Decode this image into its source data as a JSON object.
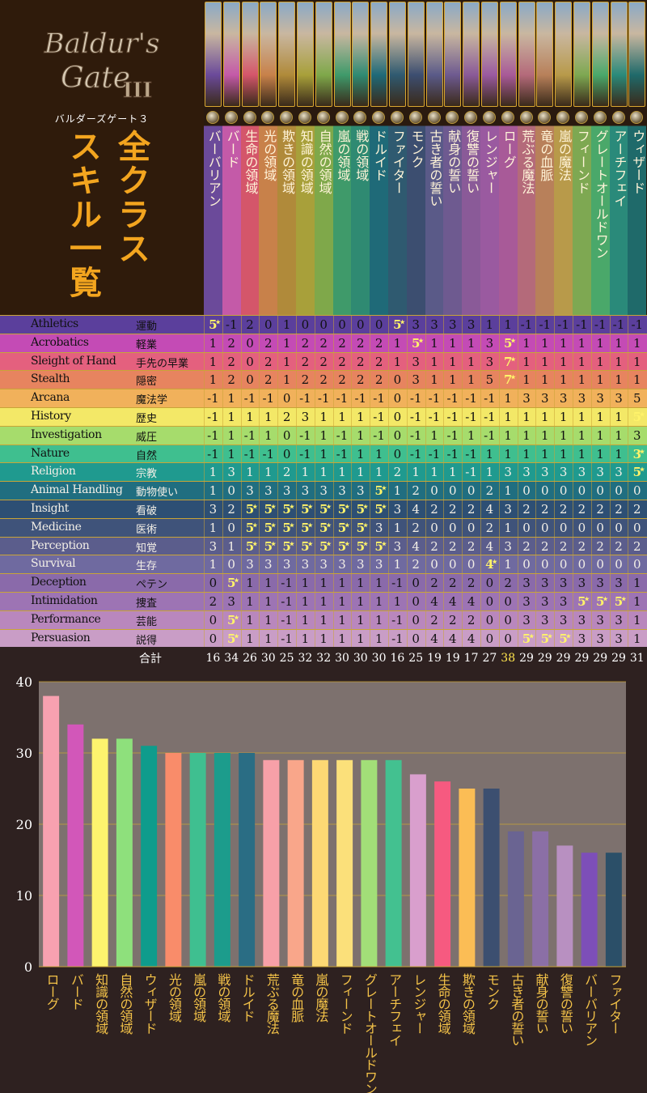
{
  "header": {
    "logo_text_line1": "Baldur's",
    "logo_text_line2": "Gate",
    "logo_numeral": "III",
    "subtitle": "バルダーズゲート３",
    "title_line1": "全クラス",
    "title_line2": "スキル一覧"
  },
  "classes": [
    {
      "label": "バーバリアン",
      "color": "#6b4a9a"
    },
    {
      "label": "バード",
      "color": "#c45aa8"
    },
    {
      "label": "生命の領域",
      "color": "#d4566a"
    },
    {
      "label": "光の領域",
      "color": "#c8814a"
    },
    {
      "label": "欺きの領域",
      "color": "#b08a3a"
    },
    {
      "label": "知識の領域",
      "color": "#a8a03a"
    },
    {
      "label": "自然の領域",
      "color": "#7fa84a"
    },
    {
      "label": "嵐の領域",
      "color": "#3f9a6a"
    },
    {
      "label": "戦の領域",
      "color": "#2f8a72"
    },
    {
      "label": "ドルイド",
      "color": "#1f6a78"
    },
    {
      "label": "ファイター",
      "color": "#2f5a70"
    },
    {
      "label": "モンク",
      "color": "#3c4e70"
    },
    {
      "label": "古き者の誓い",
      "color": "#5a5a88"
    },
    {
      "label": "献身の誓い",
      "color": "#6e5a90"
    },
    {
      "label": "復讐の誓い",
      "color": "#8a5a98"
    },
    {
      "label": "レンジャー",
      "color": "#9a5aa0"
    },
    {
      "label": "ローグ",
      "color": "#a85a98"
    },
    {
      "label": "荒ぶる魔法",
      "color": "#b46a7a"
    },
    {
      "label": "竜の血脈",
      "color": "#b8805a"
    },
    {
      "label": "嵐の魔法",
      "color": "#b89a4a"
    },
    {
      "label": "フィーンド",
      "color": "#7ea852"
    },
    {
      "label": "グレートオールドワン",
      "color": "#4aa86a"
    },
    {
      "label": "アーチフェイ",
      "color": "#2a8a7a"
    },
    {
      "label": "ウィザード",
      "color": "#1f6a6a"
    }
  ],
  "skills": [
    {
      "en": "Athletics",
      "jp": "運動",
      "bg": "#5b3f9c",
      "values": [
        5,
        -1,
        2,
        0,
        1,
        0,
        0,
        0,
        0,
        0,
        5,
        3,
        3,
        3,
        3,
        1,
        1,
        -1,
        -1,
        -1,
        -1,
        -1,
        -1,
        -1
      ],
      "max": [
        0,
        10
      ]
    },
    {
      "en": "Acrobatics",
      "jp": "軽業",
      "bg": "#c44bb5",
      "values": [
        1,
        2,
        0,
        2,
        1,
        2,
        2,
        2,
        2,
        2,
        1,
        5,
        1,
        1,
        1,
        3,
        5,
        1,
        1,
        1,
        1,
        1,
        1,
        1
      ],
      "max": [
        11,
        16
      ]
    },
    {
      "en": "Sleight of Hand",
      "jp": "手先の早業",
      "bg": "#e4607e",
      "values": [
        1,
        2,
        0,
        2,
        1,
        2,
        2,
        2,
        2,
        2,
        1,
        3,
        1,
        1,
        1,
        3,
        7,
        1,
        1,
        1,
        1,
        1,
        1,
        1
      ],
      "max": [
        16
      ]
    },
    {
      "en": "Stealth",
      "jp": "隠密",
      "bg": "#e7845f",
      "values": [
        1,
        2,
        0,
        2,
        1,
        2,
        2,
        2,
        2,
        2,
        0,
        3,
        1,
        1,
        1,
        5,
        7,
        1,
        1,
        1,
        1,
        1,
        1,
        1
      ],
      "max": [
        16
      ]
    },
    {
      "en": "Arcana",
      "jp": "魔法学",
      "bg": "#f1b15b",
      "values": [
        -1,
        1,
        -1,
        -1,
        0,
        -1,
        -1,
        -1,
        -1,
        -1,
        0,
        -1,
        -1,
        -1,
        -1,
        -1,
        1,
        3,
        3,
        3,
        3,
        3,
        3,
        5
      ],
      "max": []
    },
    {
      "en": "History",
      "jp": "歴史",
      "bg": "#f3e867",
      "values": [
        -1,
        1,
        1,
        1,
        2,
        3,
        1,
        1,
        1,
        -1,
        0,
        -1,
        -1,
        -1,
        -1,
        -1,
        1,
        1,
        1,
        1,
        1,
        1,
        1,
        5
      ],
      "max": [
        23
      ]
    },
    {
      "en": "Investigation",
      "jp": "威圧",
      "bg": "#a6dc6c",
      "values": [
        -1,
        1,
        -1,
        1,
        0,
        -1,
        1,
        -1,
        1,
        -1,
        0,
        -1,
        1,
        -1,
        1,
        -1,
        1,
        1,
        1,
        1,
        1,
        1,
        1,
        3
      ],
      "max": []
    },
    {
      "en": "Nature",
      "jp": "自然",
      "bg": "#3fbf8f",
      "values": [
        -1,
        1,
        -1,
        -1,
        0,
        -1,
        1,
        -1,
        1,
        1,
        0,
        -1,
        -1,
        -1,
        -1,
        1,
        1,
        1,
        1,
        1,
        1,
        1,
        1,
        3
      ],
      "max": [
        23
      ]
    },
    {
      "en": "Religion",
      "jp": "宗教",
      "bg": "#1f9a8f",
      "values": [
        1,
        3,
        1,
        1,
        2,
        1,
        1,
        1,
        1,
        1,
        2,
        1,
        1,
        1,
        -1,
        1,
        3,
        3,
        3,
        3,
        3,
        3,
        3,
        5
      ],
      "max": [
        23
      ]
    },
    {
      "en": "Animal Handling",
      "jp": "動物使い",
      "bg": "#206e80",
      "values": [
        1,
        0,
        3,
        3,
        3,
        3,
        3,
        3,
        3,
        5,
        1,
        2,
        0,
        0,
        0,
        2,
        1,
        0,
        0,
        0,
        0,
        0,
        0,
        0
      ],
      "max": [
        9
      ]
    },
    {
      "en": "Insight",
      "jp": "看破",
      "bg": "#2d4f74",
      "values": [
        3,
        2,
        5,
        5,
        5,
        5,
        5,
        5,
        5,
        5,
        3,
        4,
        2,
        2,
        2,
        4,
        3,
        2,
        2,
        2,
        2,
        2,
        2,
        2
      ],
      "max": [
        2,
        3,
        4,
        5,
        6,
        7,
        8,
        9
      ]
    },
    {
      "en": "Medicine",
      "jp": "医術",
      "bg": "#3f537a",
      "values": [
        1,
        0,
        5,
        5,
        5,
        5,
        5,
        5,
        5,
        3,
        1,
        2,
        0,
        0,
        0,
        2,
        1,
        0,
        0,
        0,
        0,
        0,
        0,
        0
      ],
      "max": [
        2,
        3,
        4,
        5,
        6,
        7,
        8
      ]
    },
    {
      "en": "Perception",
      "jp": "知覚",
      "bg": "#5b5d8c",
      "values": [
        3,
        1,
        5,
        5,
        5,
        5,
        5,
        5,
        5,
        5,
        3,
        4,
        2,
        2,
        2,
        4,
        3,
        2,
        2,
        2,
        2,
        2,
        2,
        2
      ],
      "max": [
        2,
        3,
        4,
        5,
        6,
        7,
        8,
        9
      ]
    },
    {
      "en": "Survival",
      "jp": "生存",
      "bg": "#6f6aa0",
      "values": [
        1,
        0,
        3,
        3,
        3,
        3,
        3,
        3,
        3,
        3,
        1,
        2,
        0,
        0,
        0,
        4,
        1,
        0,
        0,
        0,
        0,
        0,
        0,
        0
      ],
      "max": [
        15
      ]
    },
    {
      "en": "Deception",
      "jp": "ペテン",
      "bg": "#8a6aaa",
      "values": [
        0,
        5,
        1,
        1,
        -1,
        1,
        1,
        1,
        1,
        1,
        -1,
        0,
        2,
        2,
        2,
        0,
        2,
        3,
        3,
        3,
        3,
        3,
        3,
        1
      ],
      "max": [
        1
      ]
    },
    {
      "en": "Intimidation",
      "jp": "捜査",
      "bg": "#9d74b4",
      "values": [
        2,
        3,
        1,
        1,
        -1,
        1,
        1,
        1,
        1,
        1,
        1,
        0,
        4,
        4,
        4,
        0,
        0,
        3,
        3,
        3,
        5,
        5,
        5,
        1
      ],
      "max": [
        20,
        21,
        22
      ]
    },
    {
      "en": "Performance",
      "jp": "芸能",
      "bg": "#b987bd",
      "values": [
        0,
        5,
        1,
        1,
        -1,
        1,
        1,
        1,
        1,
        1,
        -1,
        0,
        2,
        2,
        2,
        0,
        0,
        3,
        3,
        3,
        3,
        3,
        3,
        1
      ],
      "max": [
        1
      ]
    },
    {
      "en": "Persuasion",
      "jp": "説得",
      "bg": "#c99dc6",
      "values": [
        0,
        5,
        1,
        1,
        -1,
        1,
        1,
        1,
        1,
        1,
        -1,
        0,
        4,
        4,
        4,
        0,
        0,
        5,
        5,
        5,
        3,
        3,
        3,
        1
      ],
      "max": [
        1,
        17,
        18,
        19
      ]
    }
  ],
  "totals": {
    "label": "合計",
    "values": [
      16,
      34,
      26,
      30,
      25,
      32,
      32,
      30,
      30,
      30,
      16,
      25,
      19,
      19,
      17,
      27,
      38,
      29,
      29,
      29,
      29,
      29,
      29,
      31
    ],
    "max_index": 16
  },
  "chart_data": {
    "type": "bar",
    "title": "",
    "xlabel": "",
    "ylabel": "",
    "ylim": [
      0,
      40
    ],
    "yticks": [
      0,
      10,
      20,
      30,
      40
    ],
    "grid": true,
    "categories": [
      "ローグ",
      "バード",
      "知識の領域",
      "自然の領域",
      "ウィザード",
      "光の領域",
      "嵐の領域",
      "戦の領域",
      "ドルイド",
      "荒ぶる魔法",
      "竜の血脈",
      "嵐の魔法",
      "フィーンド",
      "グレートオールドワン",
      "アーチフェイ",
      "レンジャー",
      "生命の領域",
      "欺きの領域",
      "モンク",
      "古き者の誓い",
      "献身の誓い",
      "復讐の誓い",
      "バーバリアン",
      "ファイター"
    ],
    "values": [
      38,
      34,
      32,
      32,
      31,
      30,
      30,
      30,
      30,
      29,
      29,
      29,
      29,
      29,
      29,
      27,
      26,
      25,
      25,
      19,
      19,
      17,
      16,
      16
    ],
    "colors": [
      "#f7a1b0",
      "#d257b9",
      "#fdf36e",
      "#8ee07c",
      "#0e9c8c",
      "#f98c6a",
      "#3fbf90",
      "#1c9c8c",
      "#2a6d84",
      "#f7a0a8",
      "#f9a68a",
      "#fdd874",
      "#fbe07a",
      "#a2de78",
      "#43c190",
      "#d99fcd",
      "#f65a80",
      "#fbbd55",
      "#3c4f70",
      "#6a6492",
      "#8b6fa6",
      "#b890c1",
      "#7d4fb8",
      "#2b4f68"
    ]
  }
}
